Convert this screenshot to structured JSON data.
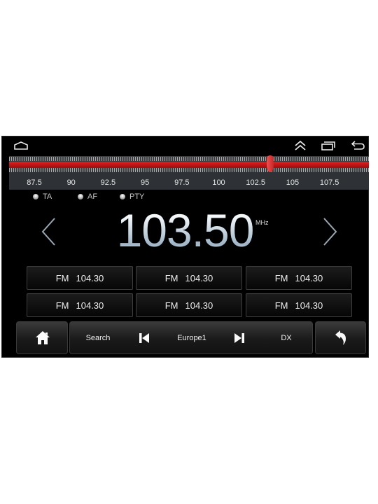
{
  "status_bar": {
    "icons": [
      "home-outline-icon",
      "chevron-double-up-icon",
      "recent-apps-icon",
      "back-icon"
    ]
  },
  "tuner": {
    "scale_labels": [
      "87.5",
      "90",
      "92.5",
      "95",
      "97.5",
      "100",
      "102.5",
      "105",
      "107.5"
    ],
    "range_mhz": [
      87.5,
      108.0
    ],
    "current_mhz": 103.5,
    "accent_color": "#d01818"
  },
  "flags": [
    {
      "label": "TA"
    },
    {
      "label": "AF"
    },
    {
      "label": "PTY"
    }
  ],
  "frequency": {
    "value": "103.50",
    "unit": "MHz"
  },
  "presets": [
    {
      "band": "FM",
      "freq": "104.30"
    },
    {
      "band": "FM",
      "freq": "104.30"
    },
    {
      "band": "FM",
      "freq": "104.30"
    },
    {
      "band": "FM",
      "freq": "104.30"
    },
    {
      "band": "FM",
      "freq": "104.30"
    },
    {
      "band": "FM",
      "freq": "104.30"
    }
  ],
  "controls": {
    "search_label": "Search",
    "station_label": "Europe1",
    "dx_label": "DX"
  }
}
